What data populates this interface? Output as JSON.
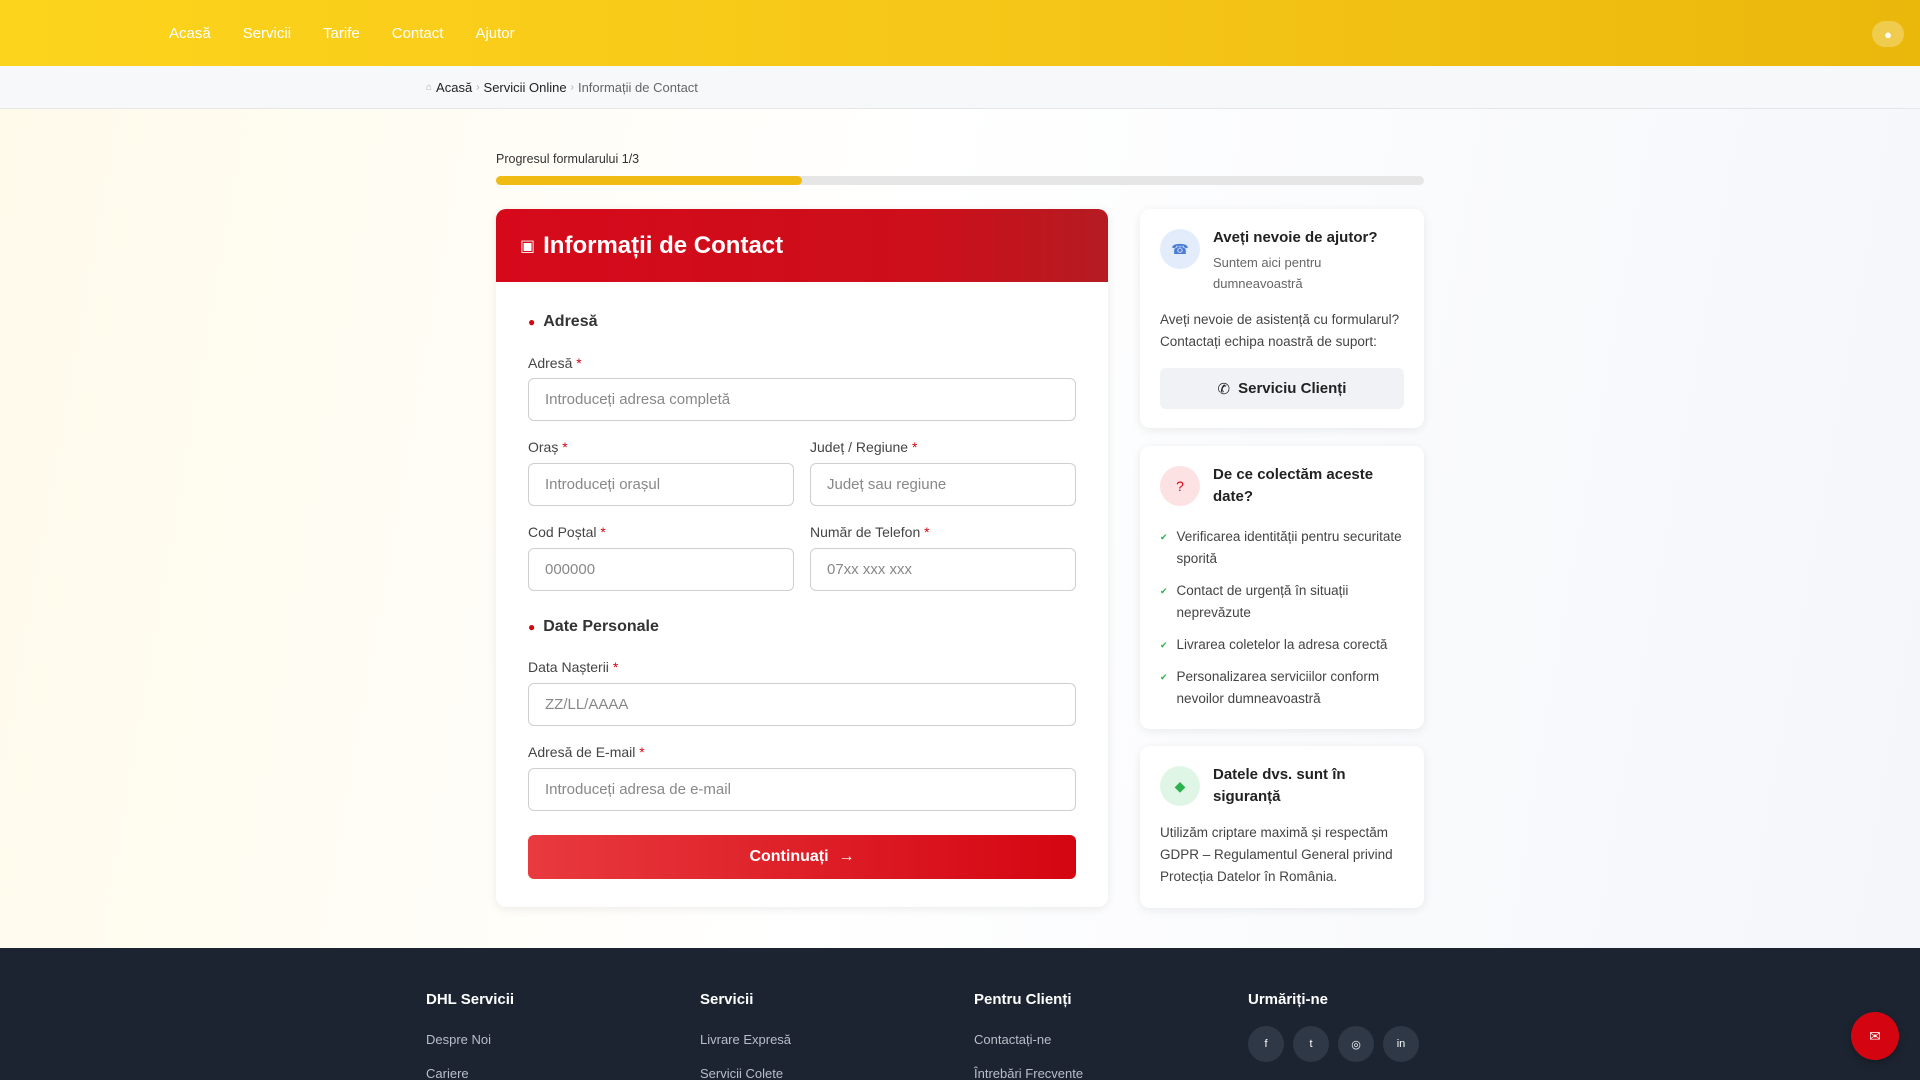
{
  "nav": {
    "items": [
      "Acasă",
      "Servicii",
      "Tarife",
      "Contact",
      "Ajutor"
    ],
    "user_icon": "user-icon"
  },
  "breadcrumb": {
    "home": "Acasă",
    "online": "Servicii Online",
    "current": "Informații de Contact"
  },
  "progress": {
    "label": "Progresul formularului 1/3",
    "fraction": 0.33
  },
  "form": {
    "title": "Informații de Contact",
    "address_section": "Adresă",
    "personal_section": "Date Personale",
    "fields": {
      "address": {
        "label": "Adresă",
        "placeholder": "Introduceți adresa completă"
      },
      "city": {
        "label": "Oraș",
        "placeholder": "Introduceți orașul"
      },
      "county": {
        "label": "Județ / Regiune",
        "placeholder": "Județ sau regiune"
      },
      "postal": {
        "label": "Cod Poștal",
        "placeholder": "000000"
      },
      "phone": {
        "label": "Număr de Telefon",
        "placeholder": "07xx xxx xxx"
      },
      "birth": {
        "label": "Data Nașterii",
        "placeholder": "ZZ/LL/AAAA"
      },
      "email": {
        "label": "Adresă de E-mail",
        "placeholder": "Introduceți adresa de e-mail"
      }
    },
    "required_mark": "*",
    "submit": "Continuați"
  },
  "help_card": {
    "title": "Aveți nevoie de ajutor?",
    "subtitle": "Suntem aici pentru dumneavoastră",
    "text": "Aveți nevoie de asistență cu formularul? Contactați echipa noastră de suport:",
    "button": "Serviciu Clienți"
  },
  "why_card": {
    "title": "De ce colectăm aceste date?",
    "items": [
      "Verificarea identității pentru securitate sporită",
      "Contact de urgență în situații neprevăzute",
      "Livrarea coletelor la adresa corectă",
      "Personalizarea serviciilor conform nevoilor dumneavoastră"
    ]
  },
  "safe_card": {
    "title": "Datele dvs. sunt în siguranță",
    "text": "Utilizăm criptare maximă și respectăm GDPR – Regulamentul General privind Protecția Datelor în România."
  },
  "footer": {
    "col1": {
      "title": "DHL Servicii",
      "links": [
        "Despre Noi",
        "Cariere"
      ]
    },
    "col2": {
      "title": "Servicii",
      "links": [
        "Livrare Expresă",
        "Servicii Colete"
      ]
    },
    "col3": {
      "title": "Pentru Clienți",
      "links": [
        "Contactați-ne",
        "Întrebări Frecvente"
      ]
    },
    "col4": {
      "title": "Urmăriți-ne",
      "socials": [
        "facebook-icon",
        "twitter-icon",
        "instagram-icon",
        "linkedin-icon"
      ]
    }
  },
  "colors": {
    "brand_yellow": "#f5c517",
    "brand_red": "#d40511",
    "footer_bg": "#1c2431"
  }
}
